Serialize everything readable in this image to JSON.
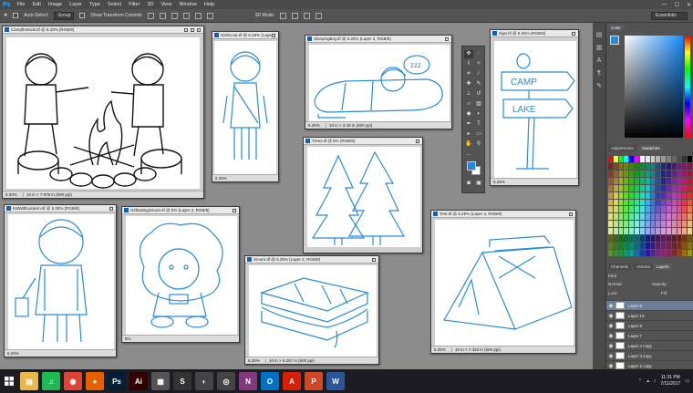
{
  "menubar": {
    "logo": "Ps",
    "items": [
      "File",
      "Edit",
      "Image",
      "Layer",
      "Type",
      "Select",
      "Filter",
      "3D",
      "View",
      "Window",
      "Help"
    ],
    "win_controls": [
      "—",
      "☐",
      "✕"
    ]
  },
  "options": {
    "auto_select_label": "Auto-Select:",
    "auto_select_value": "Group",
    "transform_label": "Show Transform Controls",
    "mode_label": "3D Mode:",
    "workspace": "Essentials"
  },
  "documents": [
    {
      "title": "CampfireKids.tif @ 8.33% (RGB/8)",
      "zoom": "8.33%",
      "info": "10 in × 7.978 in (600 ppi)"
    },
    {
      "title": "GirlScout.tif @ 6.25% (Layer 2, RGB/8)",
      "zoom": "6.25%",
      "info": ""
    },
    {
      "title": "SleepingBoy.tif @ 6.25% (Layer 2, RGB/8)",
      "zoom": "6.25%",
      "info": "10 in × 3.49 in (600 ppi)"
    },
    {
      "title": "Sign.tif @ 6.25% (RGB/8)",
      "zoom": "6.25%",
      "info": ""
    },
    {
      "title": "Trees.tif @ 5% (RGB/8)",
      "zoom": "5%",
      "info": ""
    },
    {
      "title": "KidWithLantern.tif @ 6.25% (RGB/8)",
      "zoom": "6.25%",
      "info": ""
    },
    {
      "title": "GirlEatingSmore.tif @ 5% (Layer 2, RGB/8)",
      "zoom": "5%",
      "info": ""
    },
    {
      "title": "Smore.tif @ 6.25% (Layer 2, RGB/8)",
      "zoom": "6.25%",
      "info": "10 in × 6.267 in (600 ppi)"
    },
    {
      "title": "Tent.tif @ 6.25% (Layer 4, RGB/8)",
      "zoom": "6.25%",
      "info": "10 in × 7.323 in (600 ppi)"
    }
  ],
  "sign_text": [
    "CAMP",
    "LAKE"
  ],
  "snore_text": "zzz",
  "panels": {
    "color_tab": "Color",
    "adjustments_tab": "Adjustments",
    "swatches_tab": "Swatches",
    "channels_tab": "Channels",
    "actions_tab": "Actions",
    "layers_tab": "Layers",
    "kind_label": "Kind",
    "blend_mode": "Normal",
    "opacity_label": "Opacity:",
    "lock_label": "Lock:",
    "fill_label": "Fill:",
    "layers": [
      "Layer 9",
      "Layer 10",
      "Layer 8",
      "Layer 7",
      "Layer 4 copy",
      "Layer 3 copy",
      "Layer 2 copy"
    ]
  },
  "swatch_colors": [
    "#ff0000",
    "#ffff00",
    "#00ff00",
    "#00ffff",
    "#0000ff",
    "#ff00ff",
    "#ffffff",
    "#e6e6e6",
    "#cccccc",
    "#b3b3b3",
    "#999999",
    "#808080",
    "#666666",
    "#4d4d4d",
    "#333333",
    "#000000"
  ],
  "taskbar": {
    "apps": [
      {
        "name": "explorer",
        "glyph": "▤",
        "color": "#e8b84a"
      },
      {
        "name": "spotify",
        "glyph": "♫",
        "color": "#1db954"
      },
      {
        "name": "chrome",
        "glyph": "◉",
        "color": "#db4437"
      },
      {
        "name": "firefox",
        "glyph": "●",
        "color": "#e66000"
      },
      {
        "name": "photoshop",
        "glyph": "Ps",
        "color": "#001e36"
      },
      {
        "name": "illustrator",
        "glyph": "Ai",
        "color": "#330000"
      },
      {
        "name": "calculator",
        "glyph": "▦",
        "color": "#555555"
      },
      {
        "name": "sketchbook",
        "glyph": "S",
        "color": "#333333"
      },
      {
        "name": "capture",
        "glyph": "◐",
        "color": "#444444"
      },
      {
        "name": "zoom",
        "glyph": "◎",
        "color": "#444444"
      },
      {
        "name": "onenote",
        "glyph": "N",
        "color": "#80397b"
      },
      {
        "name": "outlook",
        "glyph": "O",
        "color": "#0072c6"
      },
      {
        "name": "acrobat",
        "glyph": "A",
        "color": "#d81e05"
      },
      {
        "name": "powerpoint",
        "glyph": "P",
        "color": "#d24726"
      },
      {
        "name": "word",
        "glyph": "W",
        "color": "#2b579a"
      }
    ],
    "time": "11:31 PM",
    "date": "7/11/2017"
  }
}
